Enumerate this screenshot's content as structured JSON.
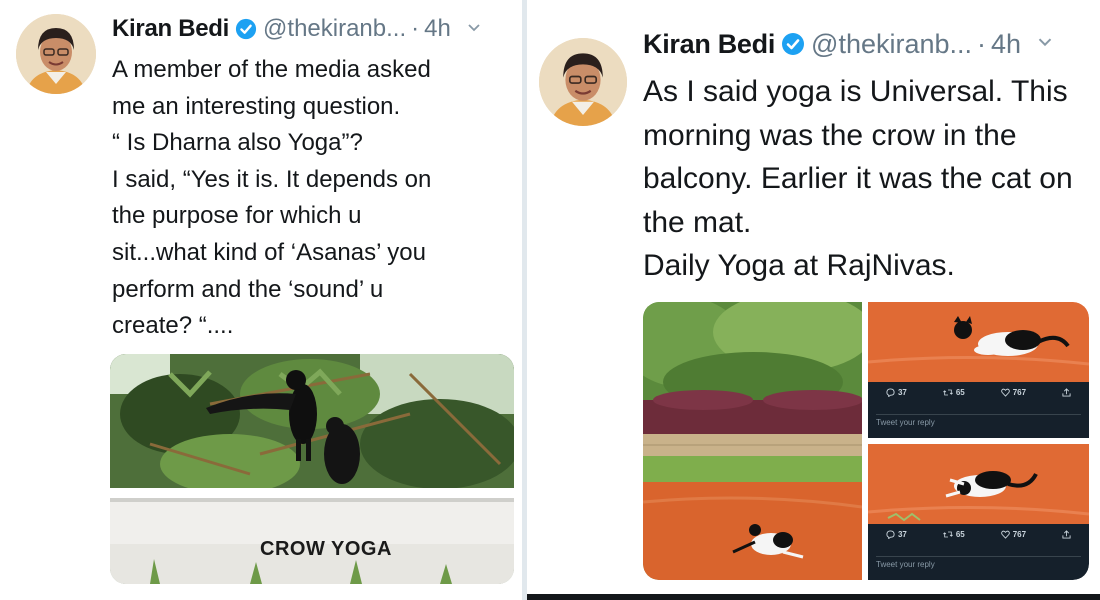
{
  "tweets": [
    {
      "author": {
        "name": "Kiran Bedi",
        "handle": "@thekiranb...",
        "time": "4h"
      },
      "separator": "·",
      "text": "A member of the media asked\nme an interesting question.\n“ Is Dharna also Yoga”?\nI said, “Yes it is. It depends on\nthe purpose for which u\nsit...what kind of ‘Asanas’ you\nperform and the ‘sound’ u\ncreate? “....",
      "media": {
        "caption": "CROW YOGA"
      }
    },
    {
      "author": {
        "name": "Kiran Bedi",
        "handle": "@thekiranb...",
        "time": "4h"
      },
      "separator": "·",
      "text": "As I said yoga is Universal. This\nmorning was the crow in the\nbalcony. Earlier it was the cat on\nthe mat.\nDaily Yoga at RajNivas.",
      "media": {
        "embedded": [
          {
            "replies": "37",
            "retweets": "65",
            "likes": "767",
            "reply_placeholder": "Tweet your reply"
          },
          {
            "replies": "37",
            "retweets": "65",
            "likes": "767",
            "reply_placeholder": "Tweet your reply"
          }
        ]
      }
    }
  ],
  "colors": {
    "verified": "#1da1f2",
    "secondary_text": "#657786",
    "orange_ground": "#d9642d"
  }
}
